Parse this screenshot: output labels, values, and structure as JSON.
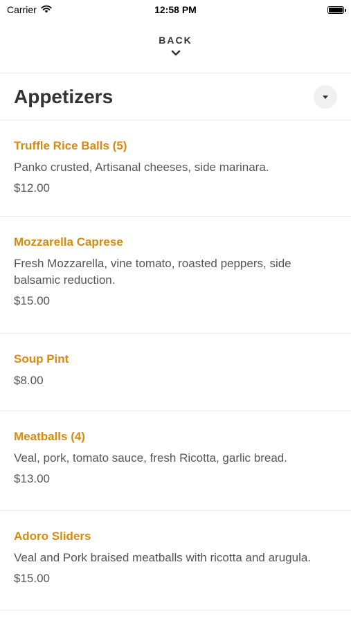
{
  "status_bar": {
    "carrier": "Carrier",
    "time": "12:58 PM"
  },
  "nav": {
    "back_label": "BACK",
    "back_icon": "chevron-down-icon"
  },
  "section": {
    "title": "Appetizers",
    "dropdown_icon": "caret-down-icon"
  },
  "colors": {
    "item_name": "#d68b0f",
    "text": "#555555",
    "divider": "#ececec"
  },
  "items": [
    {
      "name": "Truffle Rice Balls (5)",
      "description": "Panko crusted, Artisanal cheeses, side marinara.",
      "price": "$12.00"
    },
    {
      "name": "Mozzarella Caprese",
      "description": "Fresh Mozzarella, vine tomato, roasted peppers, side balsamic reduction.",
      "price": "$15.00"
    },
    {
      "name": "Soup Pint",
      "description": "",
      "price": "$8.00"
    },
    {
      "name": "Meatballs (4)",
      "description": "Veal, pork, tomato sauce, fresh Ricotta, garlic bread.",
      "price": "$13.00"
    },
    {
      "name": "Adoro Sliders",
      "description": "Veal and Pork braised meatballs with ricotta and arugula.",
      "price": "$15.00"
    }
  ]
}
